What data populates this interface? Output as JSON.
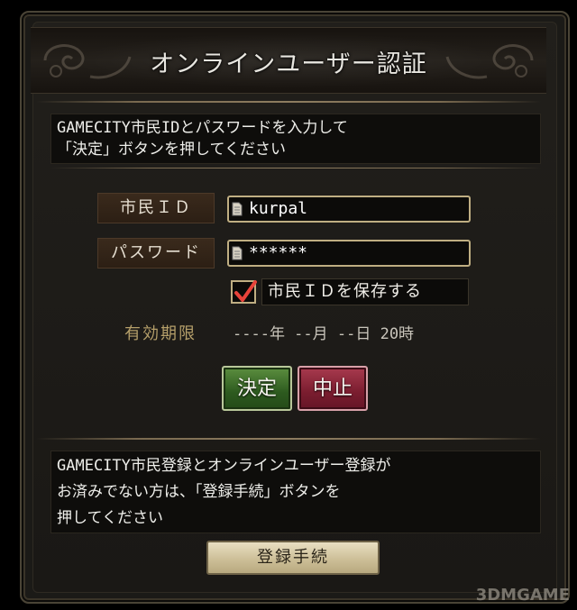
{
  "dialog": {
    "title": "オンラインユーザー認証",
    "instruction": "GAMECITY市民IDとパスワードを入力して\n「決定」ボタンを押してください"
  },
  "form": {
    "id_label": "市民ＩＤ",
    "id_value": "kurpal",
    "password_label": "パスワード",
    "password_value": "******",
    "save_checkbox_label": "市民ＩＤを保存する",
    "save_checked": true,
    "expiry_label": "有効期限",
    "expiry_value": "----年 --月 --日 20時"
  },
  "buttons": {
    "ok_label": "決定",
    "cancel_label": "中止",
    "register_label": "登録手続"
  },
  "registration": {
    "message": "GAMECITY市民登録とオンラインユーザー登録が\nお済みでない方は、「登録手続」ボタンを\n押してください"
  },
  "watermark": "3DMGAME",
  "colors": {
    "ok_button": "#2d5a1f",
    "cancel_button": "#7a1d2f",
    "field_border": "#bfae82",
    "expiry_label": "#b59f6a",
    "checkmark": "#e8433a"
  },
  "icons": {
    "field_prefix": "document-icon",
    "checkbox": "checkmark-icon",
    "title_ornament": "scroll-ornament-icon"
  }
}
